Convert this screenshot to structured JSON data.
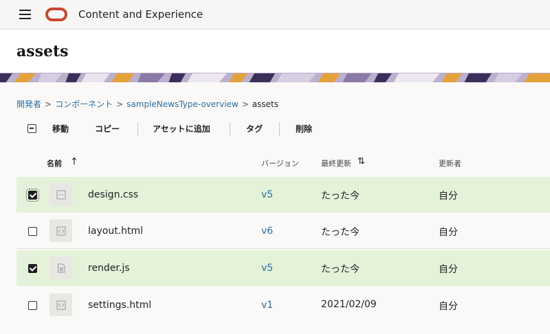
{
  "app": {
    "title": "Content and Experience"
  },
  "page": {
    "title": "assets"
  },
  "breadcrumb": {
    "items": [
      "開発者",
      "コンポーネント",
      "sampleNewsType-overview"
    ],
    "current": "assets",
    "separator": ">"
  },
  "toolbar": {
    "move": "移動",
    "copy": "コピー",
    "add_to_asset": "アセットに追加",
    "tag": "タグ",
    "delete": "削除"
  },
  "table": {
    "columns": {
      "name": "名前",
      "version": "バージョン",
      "modified": "最終更新",
      "updater": "更新者"
    },
    "sort_up_icon": "↑",
    "sort_both_icon": "⇅",
    "rows": [
      {
        "name": "design.css",
        "version": "v5",
        "modified": "たった今",
        "updater": "自分",
        "checked": true,
        "icon": "css-file-icon"
      },
      {
        "name": "layout.html",
        "version": "v6",
        "modified": "たった今",
        "updater": "自分",
        "checked": false,
        "icon": "html-file-icon"
      },
      {
        "name": "render.js",
        "version": "v5",
        "modified": "たった今",
        "updater": "自分",
        "checked": true,
        "icon": "js-file-icon"
      },
      {
        "name": "settings.html",
        "version": "v1",
        "modified": "2021/02/09",
        "updater": "自分",
        "checked": false,
        "icon": "html-file-icon"
      }
    ]
  },
  "colors": {
    "accent_link": "#2a6e9f",
    "selected_row": "#e4f2d9",
    "logo": "#c74634"
  }
}
